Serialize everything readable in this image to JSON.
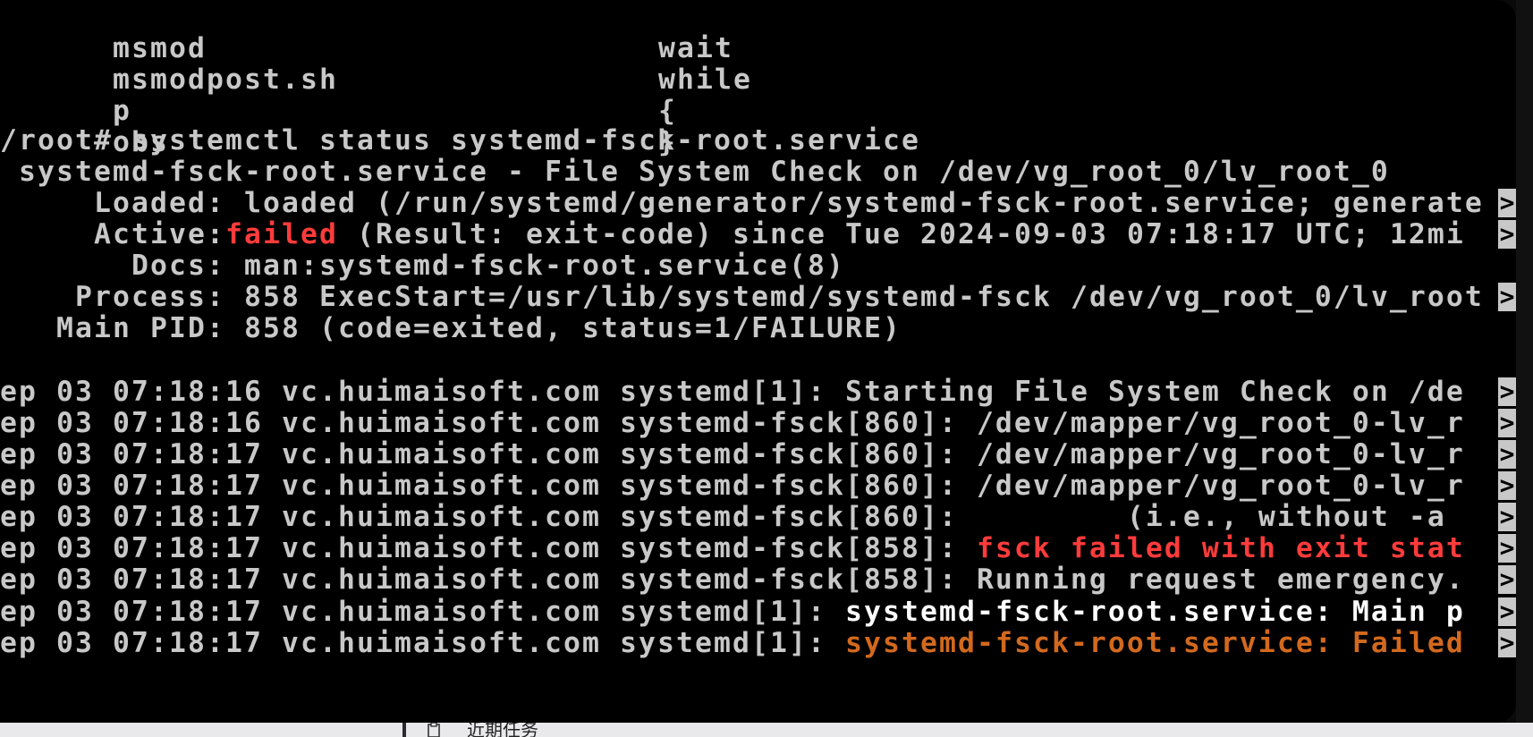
{
  "terminal": {
    "lines": [
      {
        "left": "msmod",
        "right": "wait"
      },
      {
        "left": "msmodpost.sh",
        "right": "while"
      },
      {
        "left": "p",
        "right": "{"
      },
      {
        "left": "obs",
        "right": "}"
      }
    ],
    "prompt": "/root# systemctl status systemd-fsck-root.service",
    "unit_header": " systemd-fsck-root.service - File System Check on /dev/vg_root_0/lv_root_0",
    "loaded": {
      "label": "     Loaded:",
      "value": " loaded (/run/systemd/generator/systemd-fsck-root.service; generate"
    },
    "active": {
      "label": "     Active:",
      "state": "failed",
      "rest": " (Result: exit-code) since Tue 2024-09-03 07:18:17 UTC; 12mi"
    },
    "docs": {
      "label": "       Docs:",
      "value": " man:systemd-fsck-root.service(8)"
    },
    "process": {
      "label": "    Process:",
      "value": " 858 ExecStart=/usr/lib/systemd/systemd-fsck /dev/vg_root_0/lv_root"
    },
    "main_pid": {
      "label": "   Main PID:",
      "value": " 858 (code=exited, status=1/FAILURE)"
    },
    "log": [
      {
        "prefix": "ep 03 07:18:16 vc.huimaisoft.com systemd[1]: ",
        "msg": "Starting File System Check on /de",
        "style": "normal"
      },
      {
        "prefix": "ep 03 07:18:16 vc.huimaisoft.com systemd-fsck[860]: ",
        "msg": "/dev/mapper/vg_root_0-lv_r",
        "style": "normal"
      },
      {
        "prefix": "ep 03 07:18:17 vc.huimaisoft.com systemd-fsck[860]: ",
        "msg": "/dev/mapper/vg_root_0-lv_r",
        "style": "normal"
      },
      {
        "prefix": "ep 03 07:18:17 vc.huimaisoft.com systemd-fsck[860]: ",
        "msg": "/dev/mapper/vg_root_0-lv_r",
        "style": "normal"
      },
      {
        "prefix": "ep 03 07:18:17 vc.huimaisoft.com systemd-fsck[860]: ",
        "msg": "        (i.e., without -a ",
        "style": "normal"
      },
      {
        "prefix": "ep 03 07:18:17 vc.huimaisoft.com systemd-fsck[858]: ",
        "msg": "fsck failed with exit stat",
        "style": "red"
      },
      {
        "prefix": "ep 03 07:18:17 vc.huimaisoft.com systemd-fsck[858]: ",
        "msg": "Running request emergency.",
        "style": "normal"
      },
      {
        "prefix": "ep 03 07:18:17 vc.huimaisoft.com systemd[1]: ",
        "msg": "systemd-fsck-root.service: Main p",
        "style": "white"
      },
      {
        "prefix": "ep 03 07:18:17 vc.huimaisoft.com systemd[1]: ",
        "msg": "systemd-fsck-root.service: Failed",
        "style": "orange"
      }
    ],
    "overflow_glyph": ">",
    "colors": {
      "background": "#000000",
      "text": "#c8c8c8",
      "failed": "#ff3b3b",
      "highlight": "#ffffff",
      "warning": "#d2691e"
    }
  },
  "taskbar": {
    "task_icon": "clipboard-icon",
    "task_label": "近期任务"
  }
}
